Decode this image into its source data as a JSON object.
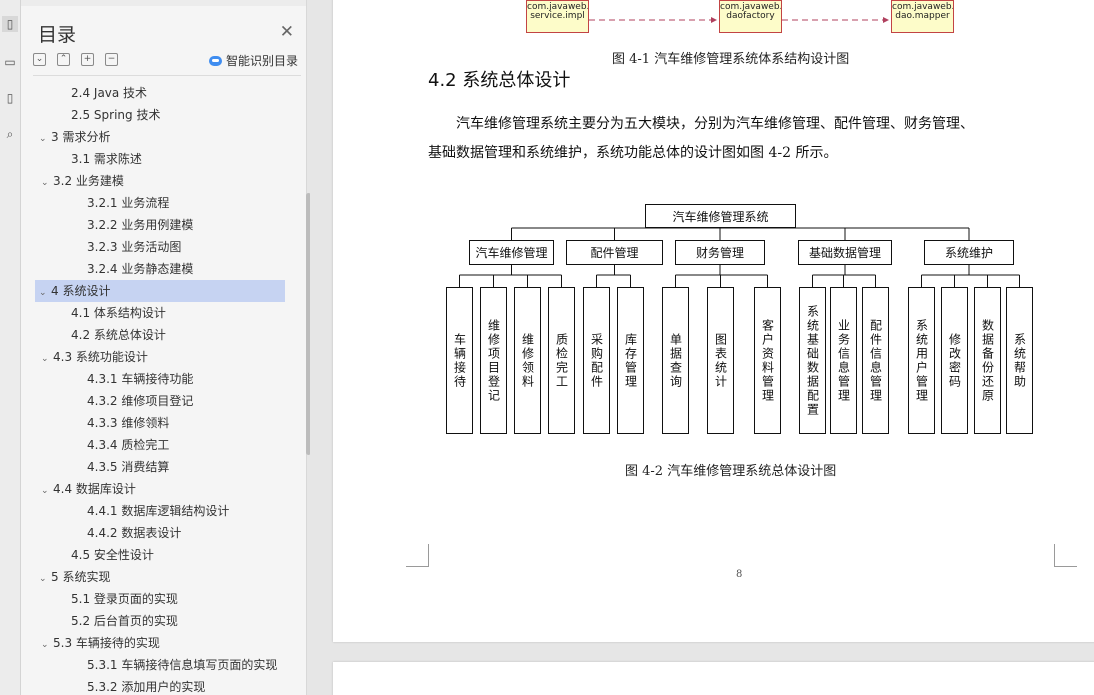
{
  "toc": {
    "title": "目录",
    "smart_label": "智能识别目录",
    "items": [
      {
        "label": "2.4 Java 技术"
      },
      {
        "label": "2.5 Spring 技术"
      },
      {
        "label": "3  需求分析"
      },
      {
        "label": "3.1  需求陈述"
      },
      {
        "label": "3.2  业务建模"
      },
      {
        "label": "3.2.1  业务流程"
      },
      {
        "label": "3.2.2  业务用例建模"
      },
      {
        "label": "3.2.3  业务活动图"
      },
      {
        "label": "3.2.4  业务静态建模"
      },
      {
        "label": "4  系统设计"
      },
      {
        "label": "4.1  体系结构设计"
      },
      {
        "label": "4.2  系统总体设计"
      },
      {
        "label": "4.3  系统功能设计"
      },
      {
        "label": "4.3.1  车辆接待功能"
      },
      {
        "label": "4.3.2  维修项目登记"
      },
      {
        "label": "4.3.3  维修领料"
      },
      {
        "label": "4.3.4  质检完工"
      },
      {
        "label": "4.3.5  消费结算"
      },
      {
        "label": "4.4  数据库设计"
      },
      {
        "label": "4.4.1  数据库逻辑结构设计"
      },
      {
        "label": "4.4.2  数据表设计"
      },
      {
        "label": "4.5  安全性设计"
      },
      {
        "label": "5  系统实现"
      },
      {
        "label": "5.1  登录页面的实现"
      },
      {
        "label": "5.2  后台首页的实现"
      },
      {
        "label": "5.3  车辆接待的实现"
      },
      {
        "label": "5.3.1  车辆接待信息填写页面的实现"
      },
      {
        "label": "5.3.2  添加用户的实现"
      }
    ]
  },
  "document": {
    "top_boxes": [
      {
        "line1": "com.javaweb.",
        "line2": "service.impl"
      },
      {
        "line1": "com.javaweb.",
        "line2": "daofactory"
      },
      {
        "line1": "com.javaweb.",
        "line2": "dao.mapper"
      }
    ],
    "figure1_caption": "图 4-1  汽车维修管理系统体系结构设计图",
    "heading": "4.2  系统总体设计",
    "paragraph_line1": "汽车维修管理系统主要分为五大模块，分别为汽车维修管理、配件管理、财务管理、",
    "paragraph_line2": "基础数据管理和系统维护，系统功能总体的设计图如图 4-2 所示。",
    "figure2_caption": "图 4-2  汽车维修管理系统总体设计图",
    "page_number": "8"
  },
  "diagram": {
    "root": "汽车维修管理系统",
    "modules": [
      {
        "name": "汽车维修管理",
        "leaves": [
          "车辆接待",
          "维修项目登记",
          "维修领料",
          "质检完工"
        ]
      },
      {
        "name": "配件管理",
        "leaves": [
          "采购配件",
          "库存管理"
        ]
      },
      {
        "name": "财务管理",
        "leaves": [
          "单据查询",
          "图表统计",
          "客户资料管理"
        ]
      },
      {
        "name": "基础数据管理",
        "leaves": [
          "系统基础数据配置",
          "业务信息管理",
          "配件信息管理"
        ]
      },
      {
        "name": "系统维护",
        "leaves": [
          "系统用户管理",
          "修改密码",
          "数据备份还原",
          "系统帮助"
        ]
      }
    ]
  }
}
